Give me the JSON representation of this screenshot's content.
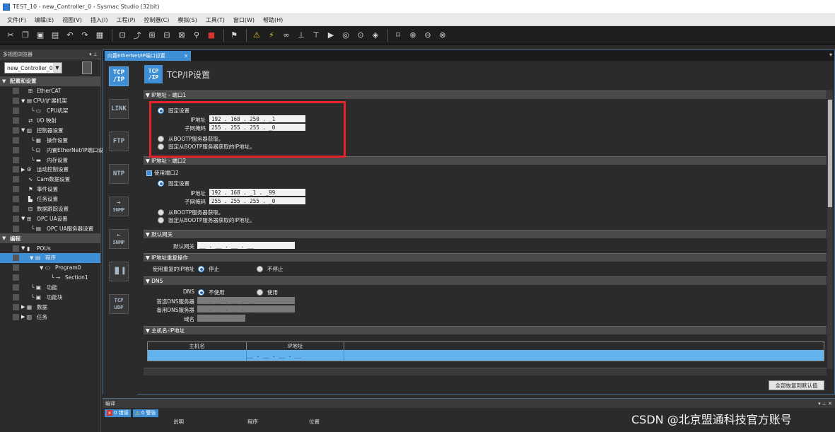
{
  "window": {
    "title": "TEST_10 - new_Controller_0 - Sysmac Studio (32bit)"
  },
  "menubar": [
    "文件(F)",
    "编辑(E)",
    "视图(V)",
    "插入(I)",
    "工程(P)",
    "控制器(C)",
    "模拟(S)",
    "工具(T)",
    "窗口(W)",
    "帮助(H)"
  ],
  "toolbar": {
    "icons": [
      "cut-icon",
      "copy-icon",
      "paste-icon",
      "delete-icon",
      "undo-icon",
      "redo-icon",
      "build-icon",
      "cross-ref-icon",
      "online-icon",
      "offline-icon",
      "transfer-icon",
      "compare-icon",
      "search-icon",
      "stop-icon",
      "sync-icon",
      "warning-icon",
      "monitor-icon",
      "link-icon",
      "set-icon",
      "reset-icon",
      "run-icon",
      "step-icon",
      "break-icon",
      "zoom-fit-icon",
      "zoom-in-icon",
      "zoom-out-icon",
      "zoom-reset-icon"
    ]
  },
  "left_panel": {
    "title": "多视图浏览器",
    "controller_select": "new_Controller_0",
    "tree": [
      {
        "label": "配置和设置",
        "section": true
      },
      {
        "label": "EtherCAT",
        "icon": "ethercat-icon"
      },
      {
        "label": "CPU/扩展机架",
        "icon": "rack-icon"
      },
      {
        "label": "CPU机架",
        "icon": "cpu-icon"
      },
      {
        "label": "I/O 映射",
        "icon": "io-icon"
      },
      {
        "label": "控制器设置",
        "icon": "controller-icon"
      },
      {
        "label": "操作设置",
        "icon": "settings-icon"
      },
      {
        "label": "内置EtherNet/IP端口设置",
        "icon": "ethernet-icon"
      },
      {
        "label": "内存设置",
        "icon": "memory-icon"
      },
      {
        "label": "运动控制设置",
        "icon": "motion-icon"
      },
      {
        "label": "Cam数据设置",
        "icon": "cam-icon"
      },
      {
        "label": "事件设置",
        "icon": "event-icon"
      },
      {
        "label": "任务设置",
        "icon": "task-icon"
      },
      {
        "label": "数据跟踪设置",
        "icon": "trace-icon"
      },
      {
        "label": "OPC UA设置",
        "icon": "opcua-icon"
      },
      {
        "label": "OPC UA服务器设置",
        "icon": "opcua-server-icon"
      },
      {
        "label": "编程",
        "section": true
      },
      {
        "label": "POUs",
        "icon": "pou-icon"
      },
      {
        "label": "程序",
        "icon": "program-icon",
        "selected": true
      },
      {
        "label": "Program0",
        "icon": "program0-icon"
      },
      {
        "label": "Section1",
        "icon": "section-icon"
      },
      {
        "label": "功能",
        "icon": "function-icon"
      },
      {
        "label": "功能块",
        "icon": "fb-icon"
      },
      {
        "label": "数据",
        "icon": "data-icon"
      },
      {
        "label": "任务",
        "icon": "task2-icon"
      }
    ]
  },
  "doc_tab": {
    "label": "内置EtherNet/IP端口设置",
    "close": "×"
  },
  "categories": [
    {
      "l1": "TCP",
      "l2": "/IP"
    },
    {
      "l1": "LINK",
      "l2": ""
    },
    {
      "l1": "FTP",
      "l2": ""
    },
    {
      "l1": "NTP",
      "l2": ""
    },
    {
      "l1": "SNMP",
      "l2": "→"
    },
    {
      "l1": "SNMP",
      "l2": "←"
    },
    {
      "l1": "",
      "l2": ""
    },
    {
      "l1": "TCP",
      "l2": "UDP"
    }
  ],
  "settings": {
    "icon_l1": "TCP",
    "icon_l2": "/IP",
    "title": "TCP/IP设置",
    "port1": {
      "header": "▼ IP地址 - 端口1",
      "fixed": "固定设置",
      "ip_label": "IP地址",
      "ip_value": "192 . 168 . 250 . _1",
      "mask_label": "子网掩码",
      "mask_value": "255 . 255 . 255 . _0",
      "bootp": "从BOOTP服务器获取。",
      "fixed_bootp": "固定从BOOTP服务器获取的IP地址。"
    },
    "port2": {
      "header": "▼ IP地址 - 端口2",
      "use_port": "使用端口2",
      "fixed": "固定设置",
      "ip_label": "IP地址",
      "ip_value": "192 . 168 . _1 . _99",
      "mask_label": "子网掩码",
      "mask_value": "255 . 255 . 255 . _0",
      "bootp": "从BOOTP服务器获取。",
      "fixed_bootp": "固定从BOOTP服务器获取的IP地址。"
    },
    "gateway": {
      "header": "▼ 默认网关",
      "label": "默认网关",
      "value": "__ . __ . __ . __"
    },
    "dup": {
      "header": "▼ IP地址重复操作",
      "label": "使用重复的IP地址",
      "stop": "停止",
      "nostop": "不停止"
    },
    "dns": {
      "header": "▼ DNS",
      "label": "DNS",
      "unused": "不使用",
      "use": "使用",
      "primary_label": "首选DNS服务器",
      "primary_value": "__ . __ . __ . __",
      "secondary_label": "备用DNS服务器",
      "secondary_value": "__ . __ . __ . __",
      "domain_label": "域名"
    },
    "hosts": {
      "header": "▼ 主机名-IP地址",
      "col_host": "主机名",
      "col_ip": "IP地址",
      "row_ip": "__ . __ . __ . __"
    },
    "restore": "全部恢复到默认值"
  },
  "bottom_panel": {
    "title": "编译",
    "errors_label": "0 错误",
    "warnings_label": "0 警告",
    "col_desc": "说明",
    "col_program": "程序",
    "col_location": "位置"
  },
  "watermark": "CSDN @北京盟通科技官方账号"
}
